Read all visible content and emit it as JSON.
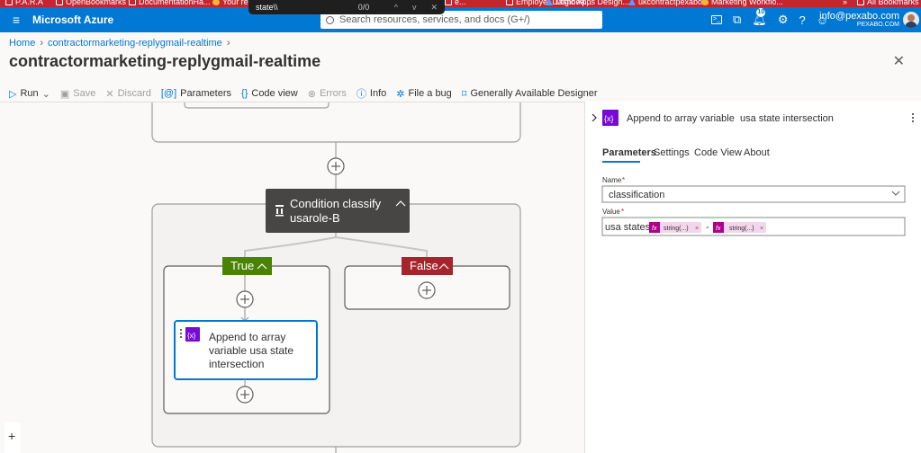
{
  "bookmarks": [
    {
      "label": "P.A.R.A",
      "icon": "folder-icon"
    },
    {
      "label": "OpenBookmarks",
      "icon": "folder-icon"
    },
    {
      "label": "DocumentationHa...",
      "icon": "folder-icon"
    },
    {
      "label": "Your re",
      "icon": "app-icon"
    },
    {
      "label": "e...",
      "icon": "page-icon"
    },
    {
      "label": "Employer Dashboa...",
      "icon": "page-icon"
    },
    {
      "label": "Logic Apps Design...",
      "icon": "azure-icon"
    },
    {
      "label": "ukcontractpexabo...",
      "icon": "azure-icon"
    },
    {
      "label": "Marketing Workflo...",
      "icon": "app-icon"
    },
    {
      "label": "»",
      "icon": ""
    },
    {
      "label": "All Bookmarks",
      "icon": "folder-icon"
    }
  ],
  "find_bar": {
    "query": "state\\\\",
    "count": "0/0"
  },
  "header": {
    "brand": "Microsoft Azure",
    "search_placeholder": "Search resources, services, and docs (G+/)",
    "notification_count": "10",
    "user_email": "info@pexabo.com",
    "user_directory": "PEXABO.COM"
  },
  "breadcrumb": {
    "home": "Home",
    "item": "contractormarketing-replygmail-realtime"
  },
  "page_title": "contractormarketing-replygmail-realtime",
  "toolbar": {
    "run": "Run",
    "save": "Save",
    "discard": "Discard",
    "parameters": "Parameters",
    "code_view": "Code view",
    "errors": "Errors",
    "info": "Info",
    "file_bug": "File a bug",
    "designer": "Generally Available Designer"
  },
  "canvas": {
    "condition_title": "Condition classify usarole-B",
    "condition_lines": [
      "Condition classify",
      "usarole-B"
    ],
    "true_label": "True",
    "false_label": "False",
    "action_title": "Append to array variable usa state intersection",
    "action_lines": [
      "Append to array",
      "variable usa state",
      "intersection"
    ],
    "zoom_plus": "+"
  },
  "panel": {
    "action_title": "Append to array variable  usa state intersection",
    "tabs": [
      "Parameters",
      "Settings",
      "Code View",
      "About"
    ],
    "active_tab": "Parameters",
    "name_label": "Name",
    "name_value": "classification",
    "value_label": "Value",
    "value_prefix": "usa states >",
    "token1": "string(...)",
    "value_dash": "-",
    "token2": "string(...)"
  },
  "colors": {
    "azure_blue": "#0078d4",
    "true_green": "#498205",
    "false_red": "#a4262c",
    "condition_gray": "#484644",
    "variable_purple": "#770bd6"
  }
}
